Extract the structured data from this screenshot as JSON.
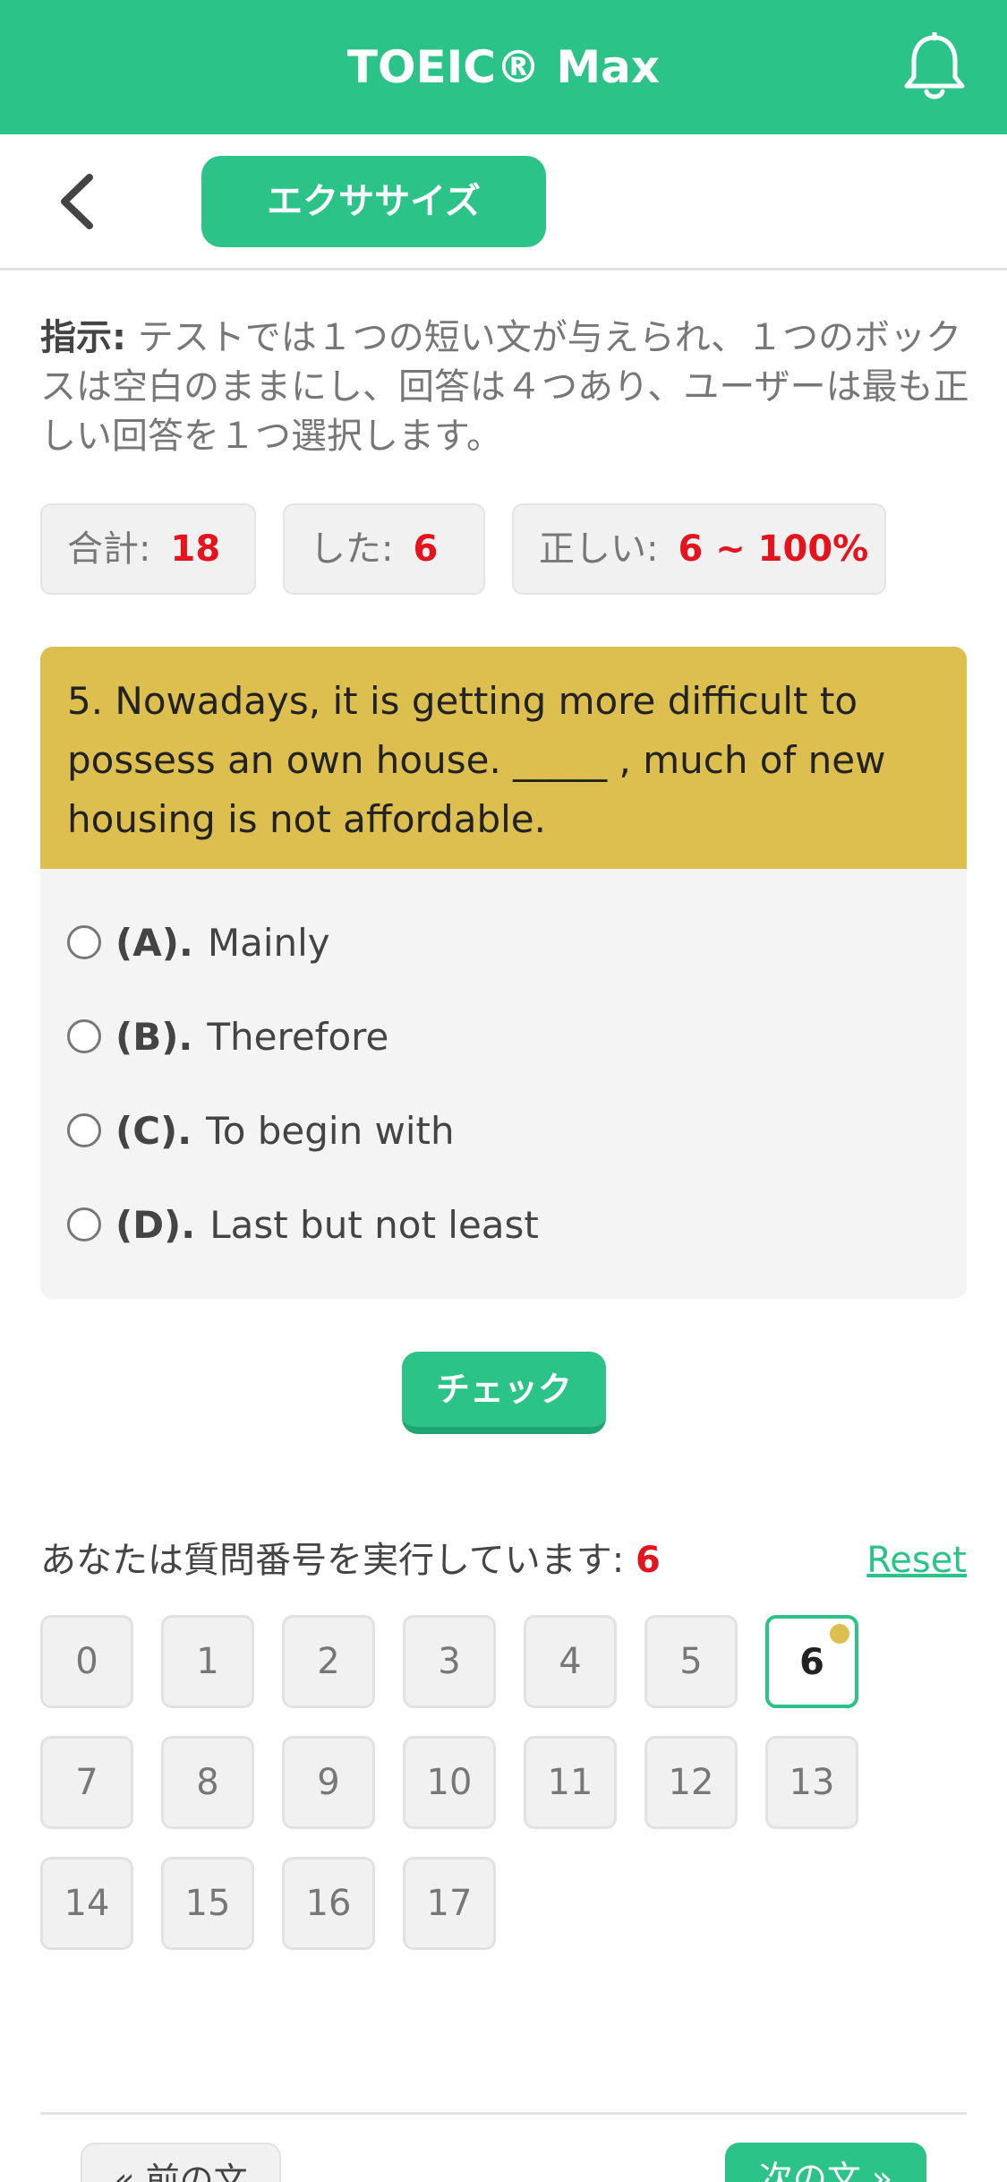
{
  "header": {
    "title": "TOEIC® Max",
    "bell_icon": "bell-icon"
  },
  "subbar": {
    "back_icon": "chevron-left-icon",
    "tab_label": "エクササイズ"
  },
  "instructions": {
    "label": "指示:",
    "text": " テストでは１つの短い文が与えられ、１つのボックスは空白のままにし、回答は４つあり、ユーザーは最も正しい回答を１つ選択します。"
  },
  "stats": {
    "total_label": "合計:",
    "total_value": "18",
    "done_label": "した:",
    "done_value": "6",
    "correct_label": "正しい:",
    "correct_value": "6 ~ 100%"
  },
  "question": {
    "text": "5. Nowadays, it is getting more difficult to possess an own house. _____ , much of new housing is not affordable.",
    "options": [
      {
        "label": "(A).",
        "text": "Mainly"
      },
      {
        "label": "(B).",
        "text": "Therefore"
      },
      {
        "label": "(C).",
        "text": "To begin with"
      },
      {
        "label": "(D).",
        "text": "Last but not least"
      }
    ]
  },
  "check_button": "チェック",
  "progress": {
    "running_label": "あなたは質問番号を実行しています:",
    "current": "6",
    "reset_label": "Reset",
    "numbers": [
      "0",
      "1",
      "2",
      "3",
      "4",
      "5",
      "6",
      "7",
      "8",
      "9",
      "10",
      "11",
      "12",
      "13",
      "14",
      "15",
      "16",
      "17"
    ]
  },
  "nav": {
    "prev_label": "« 前の文",
    "next_label": "次の文 »"
  },
  "colors": {
    "accent": "#2cc388",
    "question_bg": "#dcbf4e",
    "highlight": "#e3141e"
  }
}
